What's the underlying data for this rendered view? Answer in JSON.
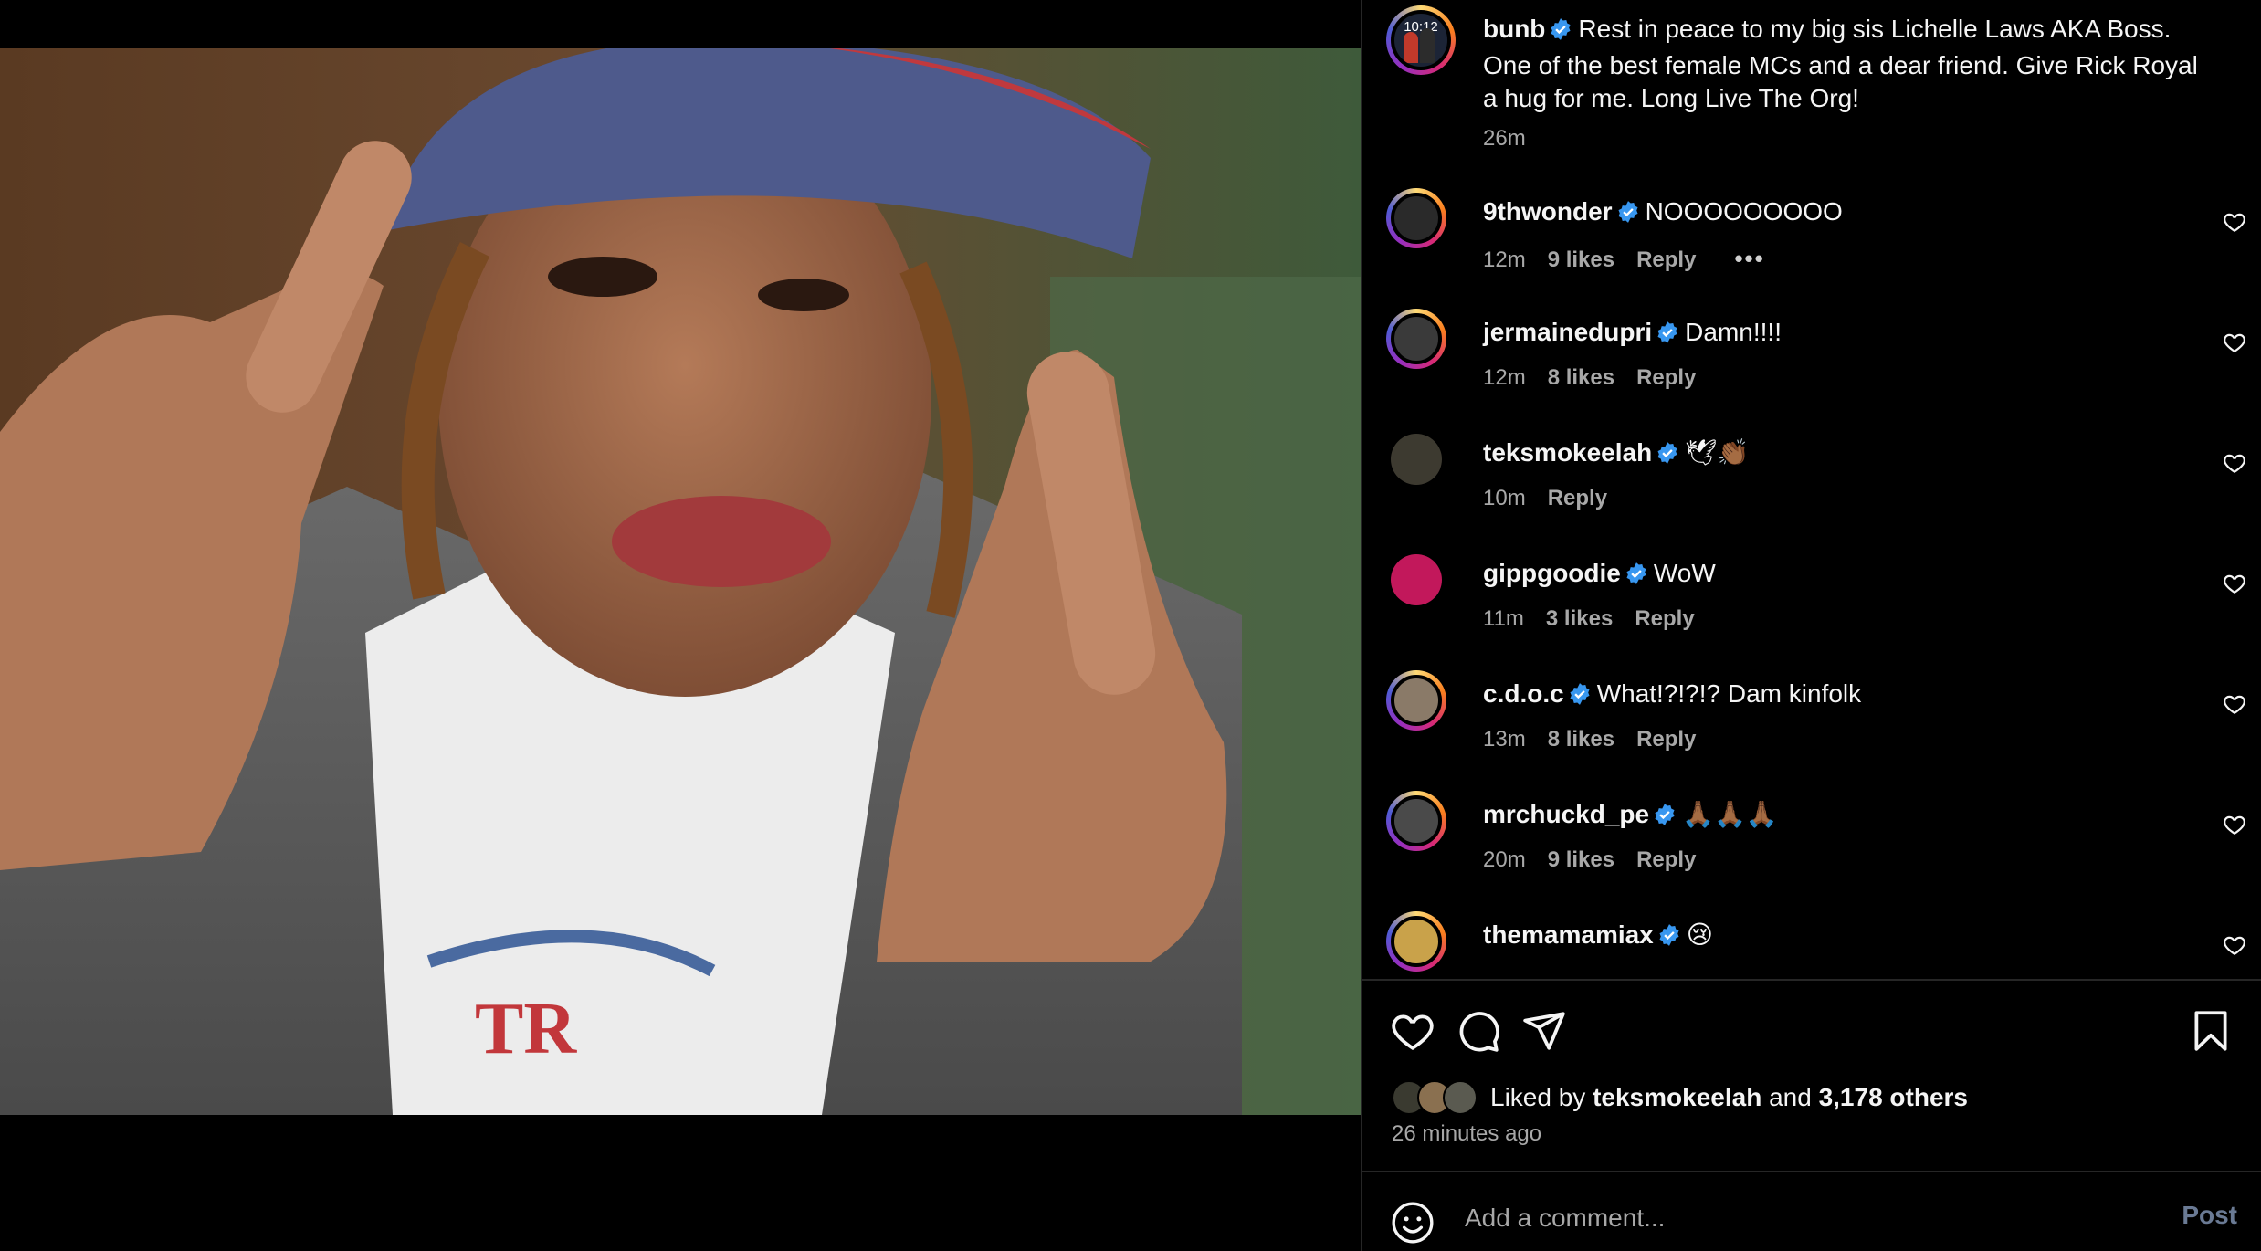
{
  "post": {
    "caption_author": "bunb",
    "caption_text": "Rest in peace to my big sis Lichelle Laws AKA Boss. One of the best female MCs and a dear friend. Give Rick Royal a hug for me. Long Live The Org!",
    "caption_time": "26m",
    "avatar_badge": "10:12"
  },
  "comments": [
    {
      "user": "9thwonder",
      "text": "NOOOOOOOOO",
      "time": "12m",
      "likes": "9 likes",
      "reply": "Reply",
      "more": "•••"
    },
    {
      "user": "jermainedupri",
      "text": "Damn!!!!",
      "time": "12m",
      "likes": "8 likes",
      "reply": "Reply"
    },
    {
      "user": "teksmokeelah",
      "text": "🕊👏🏾",
      "time": "10m",
      "likes": "",
      "reply": "Reply"
    },
    {
      "user": "gippgoodie",
      "text": "WoW",
      "time": "11m",
      "likes": "3 likes",
      "reply": "Reply"
    },
    {
      "user": "c.d.o.c",
      "text": "What!?!?!? Dam kinfolk",
      "time": "13m",
      "likes": "8 likes",
      "reply": "Reply"
    },
    {
      "user": "mrchuckd_pe",
      "text": "🙏🏾🙏🏾🙏🏾",
      "time": "20m",
      "likes": "9 likes",
      "reply": "Reply"
    },
    {
      "user": "themamamiax",
      "text": "😢",
      "time": "",
      "likes": "",
      "reply": ""
    }
  ],
  "likes": {
    "prefix": "Liked by",
    "user": "teksmokeelah",
    "joiner": "and",
    "others": "3,178 others"
  },
  "posted_ago": "26 minutes ago",
  "composer": {
    "placeholder": "Add a comment...",
    "post_label": "Post"
  },
  "colors": {
    "background": "#000000",
    "verified": "#3897f0",
    "muted_text": "#a8a8a8",
    "post_button": "#6a7a94"
  }
}
